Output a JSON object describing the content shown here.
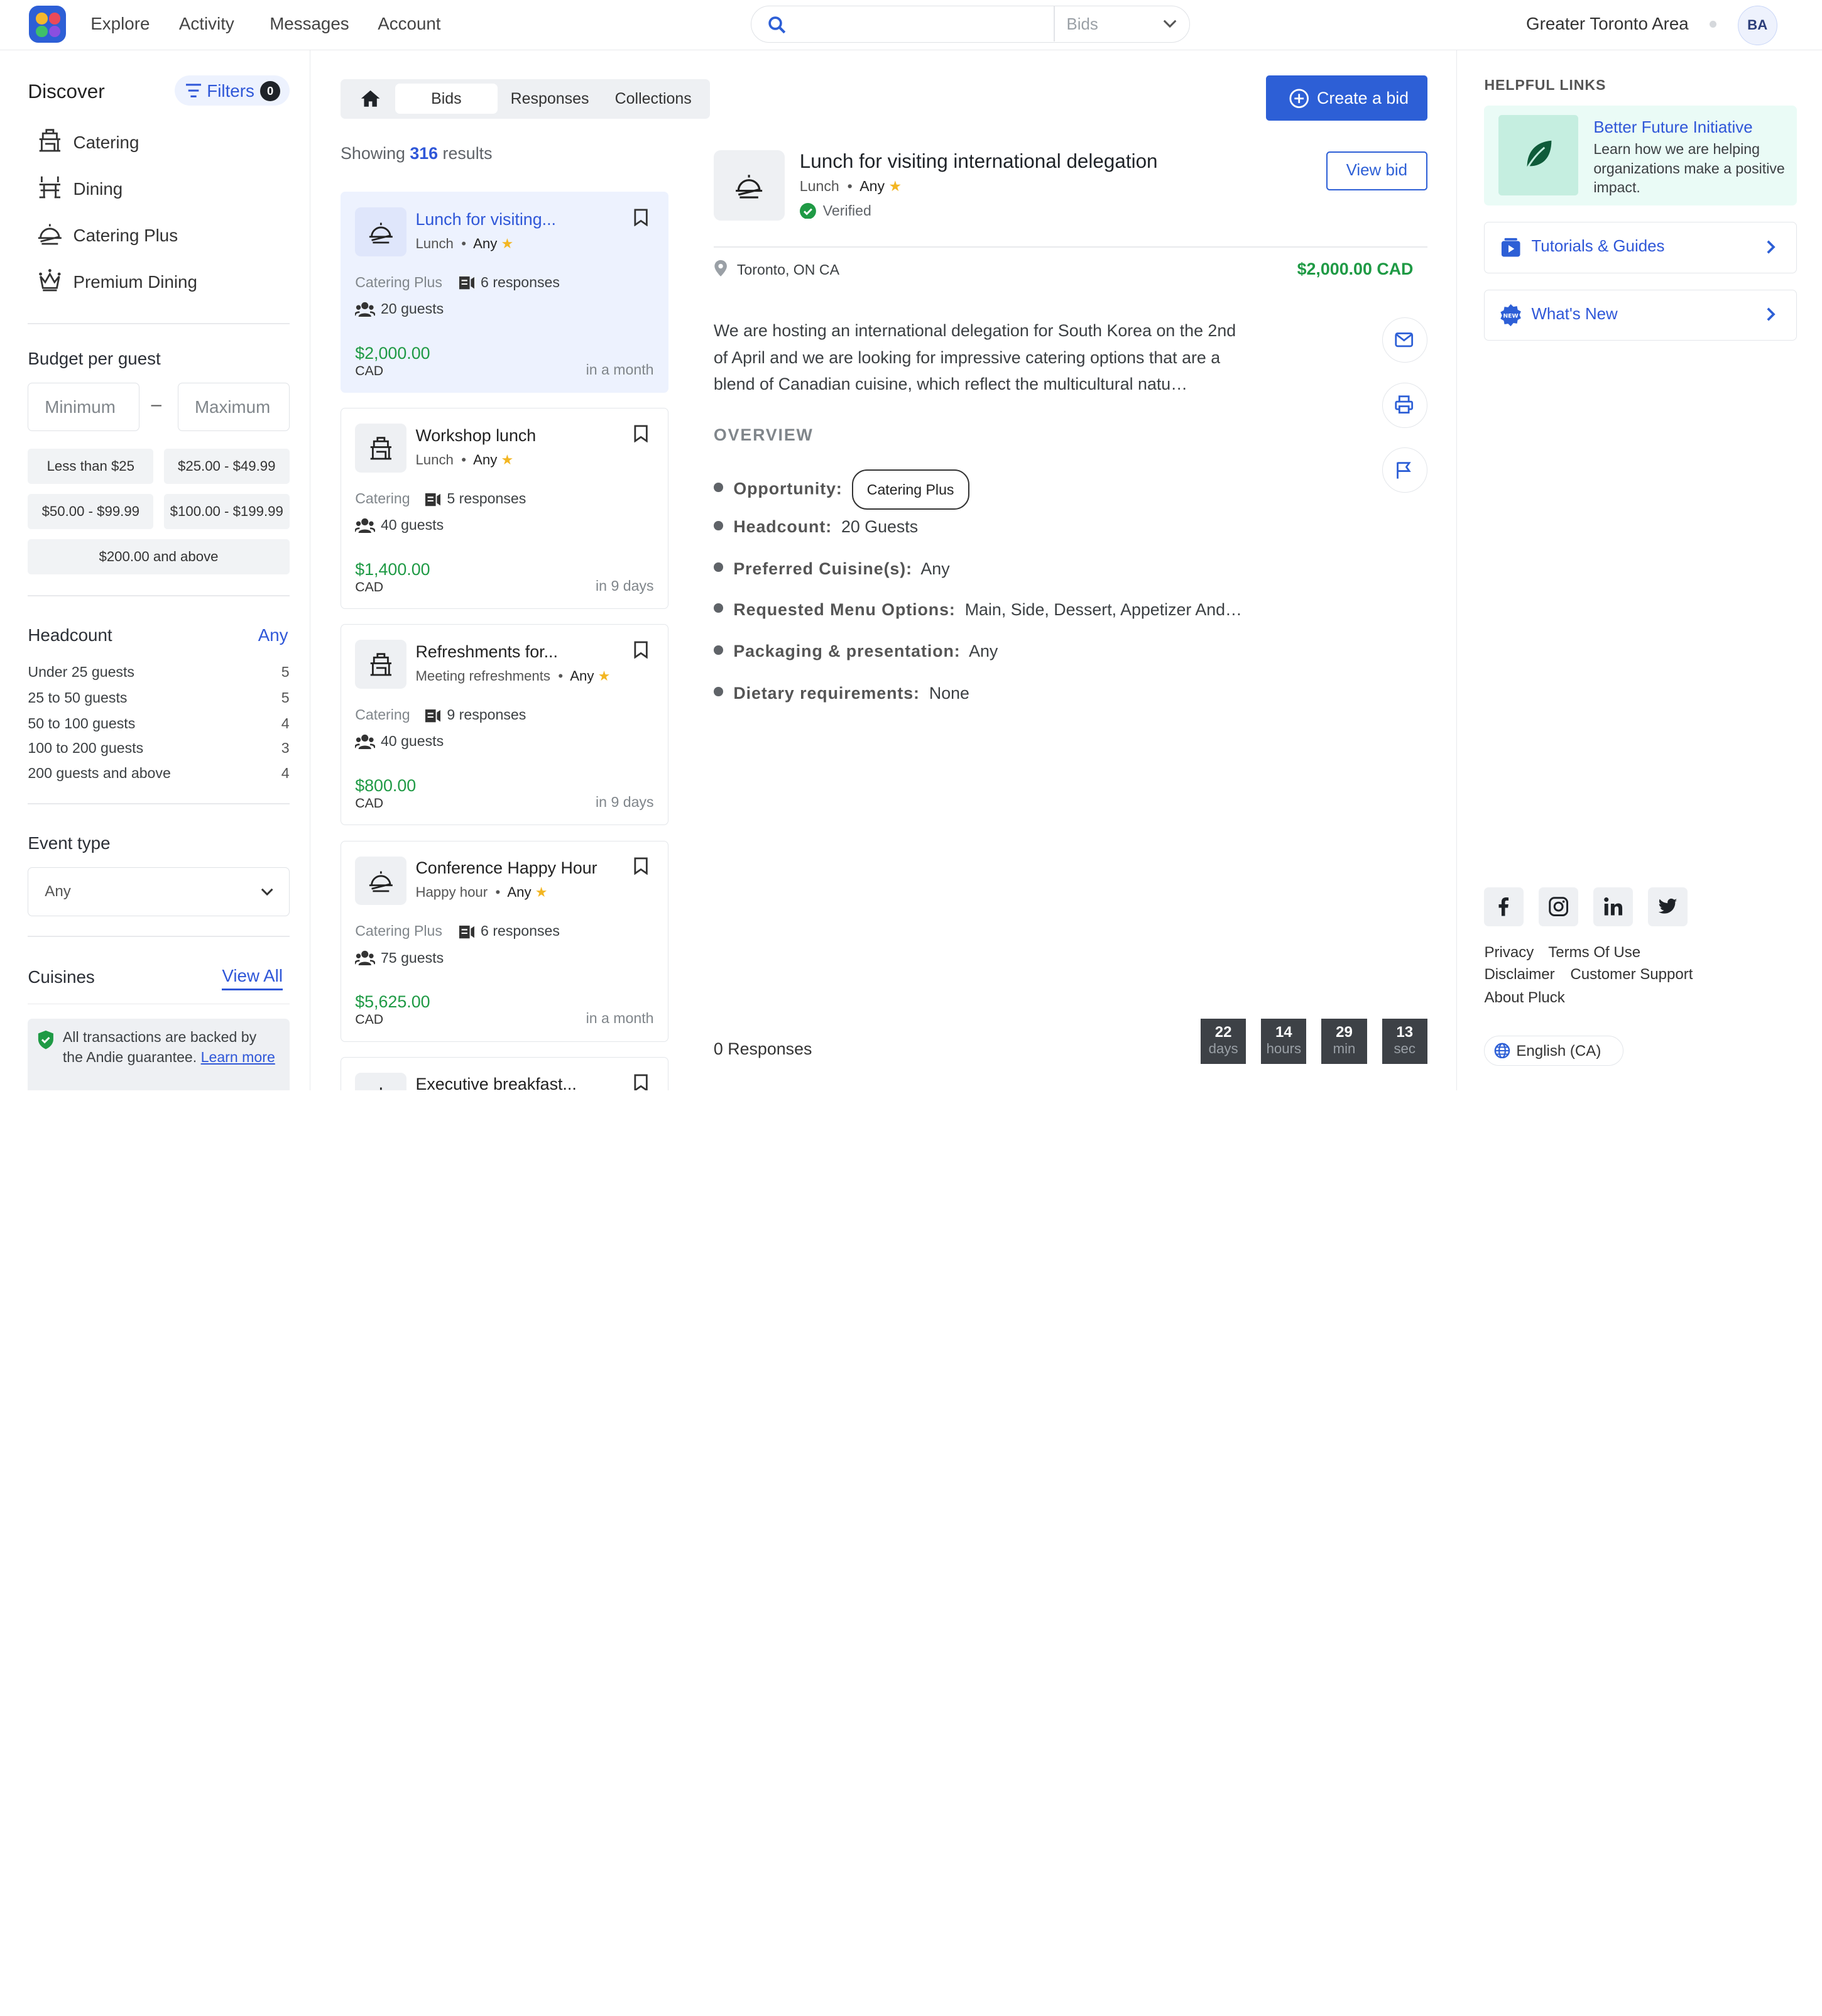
{
  "topnav": {
    "nav": [
      "Explore",
      "Activity",
      "Messages",
      "Account"
    ],
    "search_placeholder": "",
    "search_scope": "Bids",
    "region": "Greater Toronto Area",
    "avatar_initials": "BA"
  },
  "sidebar": {
    "discover": "Discover",
    "filters_label": "Filters",
    "filters_count": "0",
    "categories": [
      "Catering",
      "Dining",
      "Catering Plus",
      "Premium Dining"
    ],
    "budget_title": "Budget per guest",
    "min_placeholder": "Minimum",
    "max_placeholder": "Maximum",
    "dash": "–",
    "budget_chips": [
      "Less than $25",
      "$25.00 - $49.99",
      "$50.00 - $99.99",
      "$100.00 - $199.99",
      "$200.00 and above"
    ],
    "headcount_title": "Headcount",
    "headcount_value": "Any",
    "headcount_rows": [
      {
        "label": "Under 25 guests",
        "count": "5"
      },
      {
        "label": "25 to 50 guests",
        "count": "5"
      },
      {
        "label": "50 to 100 guests",
        "count": "4"
      },
      {
        "label": "100 to 200 guests",
        "count": "3"
      },
      {
        "label": "200 guests and above",
        "count": "4"
      }
    ],
    "event_type_title": "Event type",
    "event_type_value": "Any",
    "cuisines_title": "Cuisines",
    "cuisines_link": "View All",
    "guarantee_text": "All transactions are backed by the Andie guarantee. ",
    "guarantee_link": "Learn more"
  },
  "tabs": [
    "Bids",
    "Responses",
    "Collections"
  ],
  "results": {
    "prefix": "Showing ",
    "count": "316",
    "suffix": " results"
  },
  "cards": [
    {
      "title": "Lunch for visiting...",
      "meal": "Lunch",
      "cuisine": "Any",
      "category": "Catering Plus",
      "responses": "6 responses",
      "guests": "20 guests",
      "price": "$2,000.00",
      "currency": "CAD",
      "when": "in a month"
    },
    {
      "title": "Workshop lunch",
      "meal": "Lunch",
      "cuisine": "Any",
      "category": "Catering",
      "responses": "5 responses",
      "guests": "40 guests",
      "price": "$1,400.00",
      "currency": "CAD",
      "when": "in 9 days"
    },
    {
      "title": "Refreshments for...",
      "meal": "Meeting refreshments",
      "cuisine": "Any",
      "category": "Catering",
      "responses": "9 responses",
      "guests": "40 guests",
      "price": "$800.00",
      "currency": "CAD",
      "when": "in 9 days"
    },
    {
      "title": "Conference Happy Hour",
      "meal": "Happy hour",
      "cuisine": "Any",
      "category": "Catering Plus",
      "responses": "6 responses",
      "guests": "75 guests",
      "price": "$5,625.00",
      "currency": "CAD",
      "when": "in a month"
    },
    {
      "title": "Executive breakfast..."
    }
  ],
  "detail": {
    "create_label": "Create a bid",
    "title": "Lunch for visiting international delegation",
    "meal": "Lunch",
    "cuisine": "Any",
    "verified": "Verified",
    "view_bid": "View bid",
    "location": "Toronto, ON CA",
    "price": "$2,000.00 CAD",
    "description": "We are hosting an international delegation for South Korea on the 2nd of April and we are looking for impressive catering options that are a blend of Canadian cuisine, which reflect the multicultural natu…",
    "overview_title": "OVERVIEW",
    "overview": [
      {
        "label": "Opportunity:",
        "value": "Catering Plus"
      },
      {
        "label": "Headcount:",
        "value": "20 Guests"
      },
      {
        "label": "Preferred Cuisine(s):",
        "value": "Any"
      },
      {
        "label": "Requested Menu Options:",
        "value": "Main, Side, Dessert, Appetizer And…"
      },
      {
        "label": "Packaging & presentation:",
        "value": "Any"
      },
      {
        "label": "Dietary requirements:",
        "value": "None"
      }
    ],
    "responses": "0 Responses",
    "countdown": [
      {
        "n": "22",
        "u": "days"
      },
      {
        "n": "14",
        "u": "hours"
      },
      {
        "n": "29",
        "u": "min"
      },
      {
        "n": "13",
        "u": "sec"
      }
    ]
  },
  "right": {
    "helpful_title": "HELPFUL LINKS",
    "bfi_title": "Better Future Initiative",
    "bfi_desc": "Learn how we are helping organizations make a positive impact.",
    "tutorials": "Tutorials & Guides",
    "whats_new": "What's New",
    "footer_links": [
      "Privacy",
      "Terms Of Use",
      "Disclaimer",
      "Customer Support",
      "About Pluck"
    ],
    "language": "English (CA)"
  },
  "colors": {
    "accent": "#2d5fd6",
    "price": "#1f9a45",
    "selected_card": "#edf2fe"
  }
}
